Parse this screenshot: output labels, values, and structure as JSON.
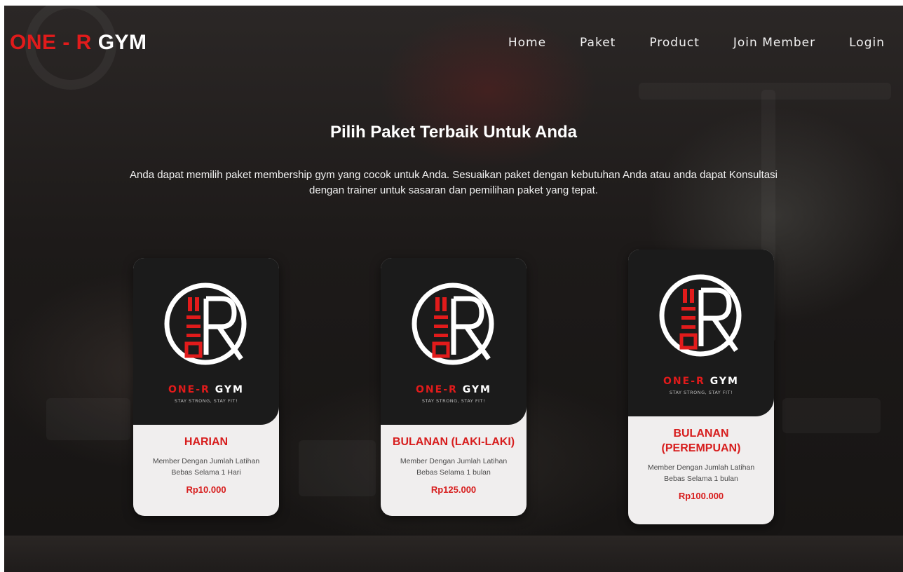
{
  "brand": {
    "part1": "ONE - R",
    "part2": "GYM"
  },
  "nav": {
    "home": "Home",
    "paket": "Paket",
    "product": "Product",
    "join": "Join Member",
    "login": "Login"
  },
  "hero": {
    "title": "Pilih Paket Terbaik Untuk Anda",
    "subtitle_line1": "Anda dapat memilih paket membership gym yang cocok untuk Anda. Sesuaikan paket dengan kebutuhan Anda atau anda dapat Konsultasi",
    "subtitle_line2": "dengan trainer untuk sasaran dan pemilihan paket yang tepat."
  },
  "logo": {
    "wordmark_red": "ONE-R",
    "wordmark_white": "GYM",
    "tagline": "STAY STRONG, STAY FIT!"
  },
  "cards": [
    {
      "title": "HARIAN",
      "desc_line1": "Member Dengan Jumlah Latihan",
      "desc_line2": "Bebas Selama 1 Hari",
      "price": "Rp10.000"
    },
    {
      "title": "BULANAN (LAKI-LAKI)",
      "desc_line1": "Member Dengan Jumlah Latihan",
      "desc_line2": "Bebas Selama 1 bulan",
      "price": "Rp125.000"
    },
    {
      "title_line1": "BULANAN",
      "title_line2": "(PEREMPUAN)",
      "desc_line1": "Member Dengan Jumlah Latihan",
      "desc_line2": "Bebas Selama 1 bulan",
      "price": "Rp100.000"
    }
  ],
  "colors": {
    "accent_red": "#e11b1b",
    "card_bg": "#f0eeee",
    "card_top": "#1b1b1b"
  }
}
